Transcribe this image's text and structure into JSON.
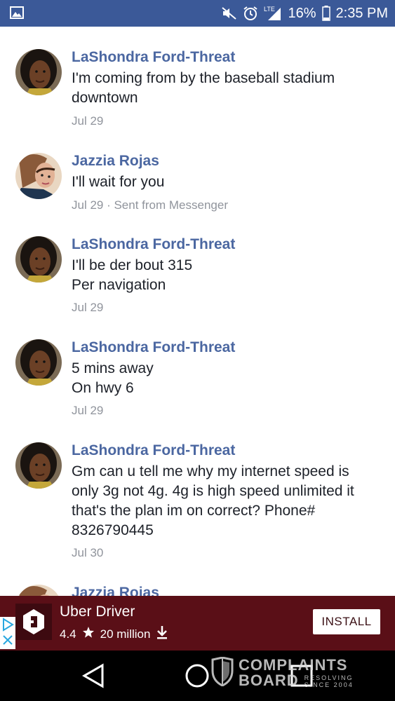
{
  "status_bar": {
    "battery": "16%",
    "time": "2:35 PM",
    "network": "LTE",
    "icons": [
      "image-icon",
      "mute-icon",
      "alarm-icon",
      "signal-icon",
      "battery-icon"
    ]
  },
  "messages": [
    {
      "name": "LaShondra Ford-Threat",
      "lines": [
        "I'm coming from by the baseball stadium downtown"
      ],
      "meta": "Jul 29",
      "avatar": "lashondra"
    },
    {
      "name": "Jazzia Rojas",
      "lines": [
        "I'll wait for you"
      ],
      "meta": "Jul 29 · Sent from Messenger",
      "avatar": "jazzia"
    },
    {
      "name": "LaShondra Ford-Threat",
      "lines": [
        "I'll be der bout 315",
        "Per navigation"
      ],
      "meta": "Jul 29",
      "avatar": "lashondra"
    },
    {
      "name": "LaShondra Ford-Threat",
      "lines": [
        "5 mins away",
        "On hwy 6"
      ],
      "meta": "Jul 29",
      "avatar": "lashondra"
    },
    {
      "name": "LaShondra Ford-Threat",
      "lines": [
        "Gm can u tell me why my internet speed is only 3g not 4g. 4g is high speed unlimited it that's the plan im on correct? Phone# 8326790445"
      ],
      "meta": "Jul 30",
      "avatar": "lashondra"
    },
    {
      "name": "Jazzia Rojas",
      "lines": [],
      "meta": "",
      "avatar": "jazzia"
    }
  ],
  "ad": {
    "title": "Uber Driver",
    "rating": "4.4",
    "installs": "20 million",
    "button": "INSTALL",
    "colors": {
      "background": "#5a0f17"
    }
  },
  "navbar": {
    "icons": [
      "back-icon",
      "home-icon",
      "recents-icon"
    ]
  },
  "watermark": {
    "line1": "COMPLAINTS",
    "line2": "BOARD",
    "tag1": "RESOLVING",
    "tag2": "SINCE 2004"
  },
  "colors": {
    "status_bar": "#3b5998",
    "name": "#4b67a1",
    "meta": "#90949c"
  }
}
